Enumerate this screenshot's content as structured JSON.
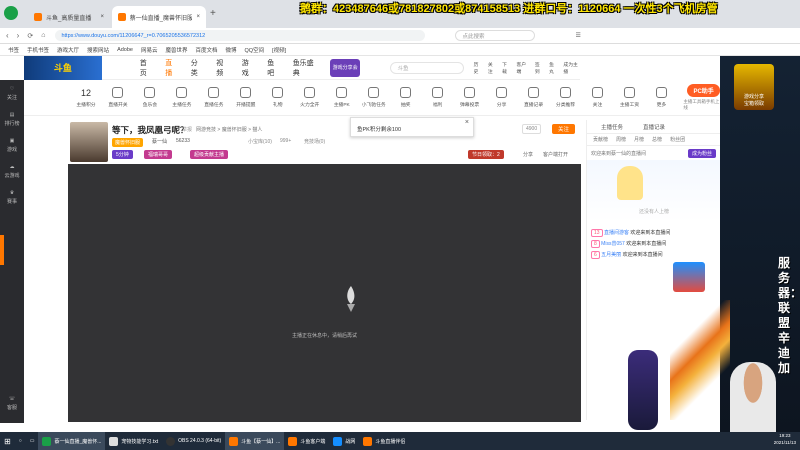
{
  "browser": {
    "tabs": [
      {
        "label": "斗鱼_高质量直播"
      },
      {
        "label": "蔡一仙直播_魔兽怀旧服直播_斗..."
      }
    ],
    "url": "https://www.douyu.com/11206647_r=0.7065205536572312",
    "search_placeholder": "点此搜索",
    "bookmarks": [
      "书签",
      "手机书签",
      "游戏大厅",
      "搜索网站",
      "Adobe",
      "网易云",
      "魔兽世界",
      "百度文档",
      "微博",
      "QQ空间",
      "[视频]"
    ]
  },
  "overlay": {
    "text": "鹅群：423487646或781827802或874158513    进群口号：1120664    一次性3个飞机房管"
  },
  "douyu_header": {
    "logo": "斗鱼",
    "nav": [
      "首页",
      "直播",
      "分类",
      "视频",
      "游戏",
      "鱼吧",
      "鱼乐盛典"
    ],
    "banner": "游戏分享会",
    "search_placeholder": "斗鱼",
    "user_actions": [
      "历史",
      "关注",
      "下载",
      "客户端",
      "签到",
      "鱼丸",
      "成为主播"
    ]
  },
  "left_sidebar": {
    "items": [
      "关注",
      "排行榜",
      "游戏",
      "云游戏",
      "赛事"
    ],
    "bottom": "客服"
  },
  "toolbar": {
    "level_number": "12",
    "level_label": "主播积分",
    "items": [
      "直播开关",
      "鱼乐会",
      "主播任务",
      "直播任务",
      "开播提醒",
      "礼物",
      "火力全开",
      "主播PK",
      "小飞驰任务",
      "抽奖",
      "福利",
      "弹幕投票",
      "分享",
      "直播记录",
      "分类推荐",
      "关注",
      "主播工资",
      "更多"
    ],
    "pc_button": "PC助手",
    "pc_sub": "主播工具箱手机上线"
  },
  "streamer": {
    "title": "等下，我凤凰弓呢？",
    "tag": "举报",
    "category_path": "网游竞技 > 魔兽怀旧服 > 猫人",
    "follow": "关注",
    "nickname": "蔡一仙",
    "fans": "56233",
    "badge_text": "魔兽怀旧服",
    "tags": [
      "5分钟",
      "福瑞哥哥",
      "超级贡献主播"
    ],
    "online": "小宝库(10)",
    "views": "999+",
    "report_label": "竞技场(0)",
    "share_label": "分享",
    "client_label": "客户端打开",
    "level_badge": "4900",
    "card_label": "充值",
    "gift_badge": "节日领取：2"
  },
  "popup": {
    "text": "鱼PK积分剩余100",
    "close": "×"
  },
  "player": {
    "status_text": "主播正在休息中，请稍后再试"
  },
  "chat": {
    "header_tabs": [
      "主播任务",
      "直播记录"
    ],
    "rank_tabs": [
      "贡献榜",
      "周榜",
      "月榜",
      "总榜",
      "粉丝团"
    ],
    "welcome": "欢迎来到蔡一仙的直播间",
    "tip_button": "成为粉丝",
    "empty_text": "还没有人上榜",
    "messages": [
      {
        "level": "13",
        "user": "直播间游客",
        "text": "欢迎来到本直播间"
      },
      {
        "level": "8",
        "user": "Miss曾057",
        "text": "欢迎来到本直播间"
      },
      {
        "level": "6",
        "user": "五月美丽",
        "text": "欢迎来到本直播间"
      }
    ]
  },
  "camera": {
    "vertical_text": "服务器：联盟辛迪加",
    "ad_line1": "游戏分享",
    "ad_line2": "宝箱领取"
  },
  "taskbar": {
    "items": [
      "蔡一仙直播_魔兽怀...",
      "宠物技能学习.txt",
      "OBS 24.0.3 (64-bit)",
      "斗鱼【蔡一仙】...",
      "斗鱼客户端",
      "战网",
      "斗鱼直播伴侣"
    ],
    "time": "19:23",
    "date": "2021/11/13"
  },
  "colors": {
    "accent": "#ff5d23",
    "douyu_orange": "#ff7700",
    "dark": "#333335",
    "overlay_yellow": "#ffe600"
  }
}
